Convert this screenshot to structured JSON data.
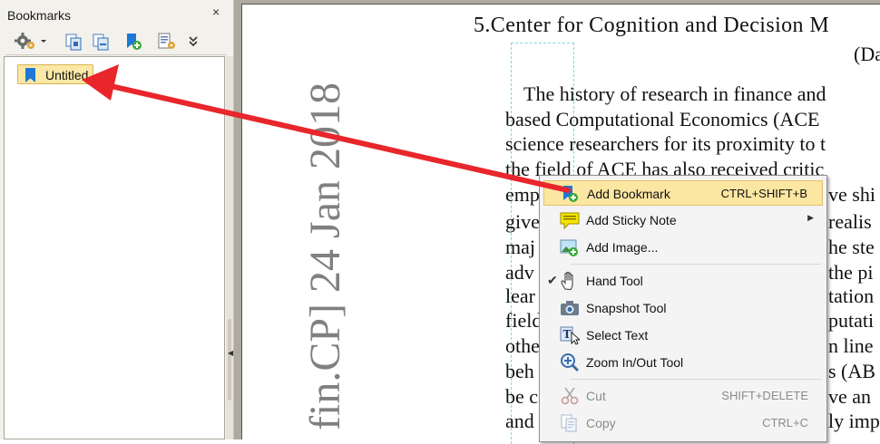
{
  "panel": {
    "title": "Bookmarks",
    "close_glyph": "×",
    "toolbar": [
      {
        "name": "options-gear-icon"
      },
      {
        "name": "expand-bookmark-icon"
      },
      {
        "name": "collapse-bookmark-icon"
      },
      {
        "name": "add-bookmark-icon"
      },
      {
        "name": "bookmark-properties-icon"
      },
      {
        "name": "toolbar-overflow-icon"
      }
    ],
    "bookmarks": [
      {
        "label": "Untitled",
        "selected": true
      }
    ]
  },
  "document": {
    "heading": "5.Center for Cognition and Decision M",
    "heading_line2": "(Da",
    "body_lines": [
      "The history of research in finance and",
      "based Computational Economics (ACE",
      "science researchers for its proximity to t",
      "the field of ACE has also received critic",
      "emp",
      "give",
      "maj",
      "adv",
      "lear",
      "field",
      "othe",
      "beh",
      "be c",
      "and"
    ],
    "body_fragments": [
      "ve shi",
      "realis",
      "he ste",
      "the pi",
      "tation",
      "putati",
      "n line",
      "s (AB",
      "ve an",
      "ly imp"
    ],
    "arxiv_stamp": "fin.CP]  24 Jan 2018"
  },
  "context_menu": {
    "items": [
      {
        "id": "add-bookmark",
        "label": "Add Bookmark",
        "shortcut": "CTRL+SHIFT+B",
        "highlighted": true
      },
      {
        "id": "add-sticky-note",
        "label": "Add Sticky Note",
        "submenu": true
      },
      {
        "id": "add-image",
        "label": "Add Image..."
      },
      {
        "id": "hand-tool",
        "label": "Hand Tool",
        "checked": true
      },
      {
        "id": "snapshot-tool",
        "label": "Snapshot Tool"
      },
      {
        "id": "select-text",
        "label": "Select Text"
      },
      {
        "id": "zoom-tool",
        "label": "Zoom In/Out Tool"
      },
      {
        "id": "cut",
        "label": "Cut",
        "shortcut": "SHIFT+DELETE",
        "disabled": true
      },
      {
        "id": "copy",
        "label": "Copy",
        "shortcut": "CTRL+C",
        "disabled": true
      }
    ],
    "check_glyph": "✔",
    "submenu_glyph": "▶"
  },
  "colors": {
    "arrow": "#e8262b",
    "highlight": "#fbe6a2",
    "stamp_gray": "#808080",
    "frame_gray": "#aeaa9f"
  }
}
